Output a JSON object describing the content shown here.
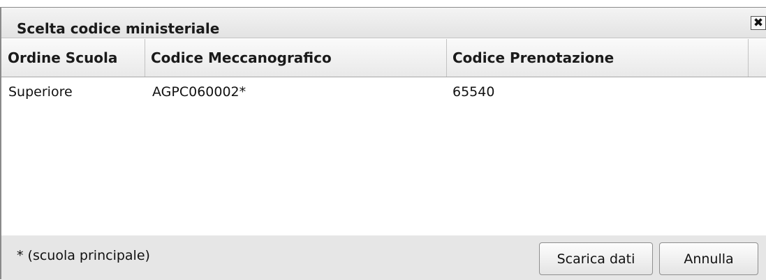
{
  "dialog": {
    "title": "Scelta codice ministeriale",
    "close_icon": "close-icon",
    "close_glyph": "✖"
  },
  "table": {
    "columns": [
      "Ordine Scuola",
      "Codice Meccanografico",
      "Codice Prenotazione",
      ""
    ],
    "rows": [
      [
        "Superiore",
        "AGPC060002*",
        "65540"
      ]
    ]
  },
  "footer": {
    "note": "* (scuola principale)",
    "download_label": "Scarica dati",
    "cancel_label": "Annulla"
  }
}
